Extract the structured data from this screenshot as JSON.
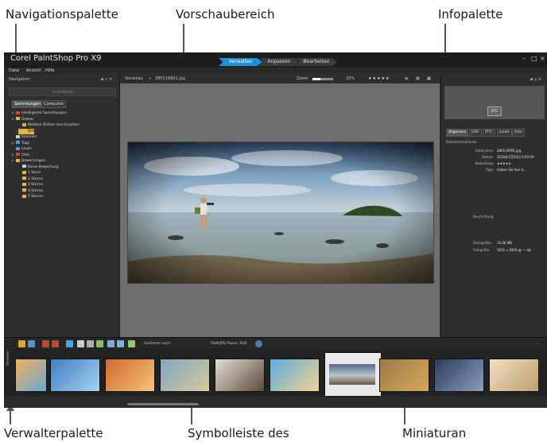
{
  "callouts": {
    "navigation_palette": "Navigationspalette",
    "preview_area": "Vorschaubereich",
    "info_palette": "Infopalette",
    "manager_palette": "Verwalterpalette",
    "toolbar_of": "Symbolleiste des",
    "thumbnails": "Miniaturan"
  },
  "app": {
    "title": "Corel PaintShop Pro X9",
    "workspace_tabs": [
      "Verwalten",
      "Anpassen",
      "Bearbeiten"
    ],
    "active_tab": "Verwalten",
    "window_controls": [
      "–",
      "□",
      "×"
    ],
    "menu": [
      "Datei",
      "Ansicht",
      "Hilfe"
    ]
  },
  "navigation": {
    "title": "Navigation",
    "search_placeholder": "Schnellsuche",
    "tabs": [
      "Sammlungen",
      "Computer"
    ],
    "tree": [
      {
        "label": "Intelligente Sammlungen",
        "icon": "smart-collection-icon",
        "color": "#d44b2a"
      },
      {
        "label": "Ordner",
        "icon": "folder-icon",
        "color": "#e2b33c"
      },
      {
        "label": "Weitere Ordner durchsuchen",
        "icon": "folder-icon",
        "color": "#e2b33c"
      },
      {
        "label": "Bild",
        "icon": "folder-icon",
        "color": "#e2b33c",
        "selected": true
      },
      {
        "label": "Kalender",
        "icon": "calendar-icon",
        "color": "#cccccc"
      },
      {
        "label": "Tags",
        "icon": "tag-icon",
        "color": "#4aa3df"
      },
      {
        "label": "Leute",
        "icon": "people-icon",
        "color": "#4aa3df"
      },
      {
        "label": "Orte",
        "icon": "place-icon",
        "color": "#d43c3c"
      },
      {
        "label": "Bewertungen",
        "icon": "star-icon",
        "color": "#e8b630"
      },
      {
        "label": "Keine Bewertung",
        "icon": "star-icon",
        "color": "#cccccc"
      },
      {
        "label": "1 Stern",
        "icon": "star-icon",
        "color": "#e8b630"
      },
      {
        "label": "2 Sterne",
        "icon": "star-icon",
        "color": "#e8b630"
      },
      {
        "label": "3 Sterne",
        "icon": "star-icon",
        "color": "#e8b630"
      },
      {
        "label": "4 Sterne",
        "icon": "star-icon",
        "color": "#e8b630"
      },
      {
        "label": "5 Sterne",
        "icon": "star-icon",
        "color": "#e8b630"
      }
    ]
  },
  "preview": {
    "label": "Vorschau",
    "breadcrumb_sep": "»",
    "filename": "280119991.jpg",
    "zoom_label": "Zoom",
    "zoom_value": "15%",
    "zoom_fraction": 0.4,
    "rating_stars": "★★★★★"
  },
  "info": {
    "ext": "JPG",
    "tabs": [
      "Allgemein",
      "EXIF",
      "IPTC",
      "Leute",
      "Orte"
    ],
    "section": "Dateiinformationen",
    "fields": [
      {
        "label": "Dateiname:",
        "value": "280119991.jpg"
      },
      {
        "label": "Datum:",
        "value": "2016年7月10日 9:03:20"
      },
      {
        "label": "Bewertung:",
        "value": "★★★★★"
      },
      {
        "label": "Tags:",
        "value": "Geben Sie hier d..."
      }
    ],
    "description_label": "Beschriftung:",
    "filesize_label": "Dateigröße:",
    "filesize_value": "10.46 MB",
    "imagesize_label": "Fotogröße:",
    "imagesize_value": "3031 x 2005 @ — dpi"
  },
  "toolbar": {
    "sort_label": "Sortieren nach:",
    "filter_label": "RAW/JPG-Paare: AUS"
  },
  "filmstrip": {
    "side_label": "Verwalter",
    "thumbnail_count": 10,
    "selected_index": 6
  }
}
